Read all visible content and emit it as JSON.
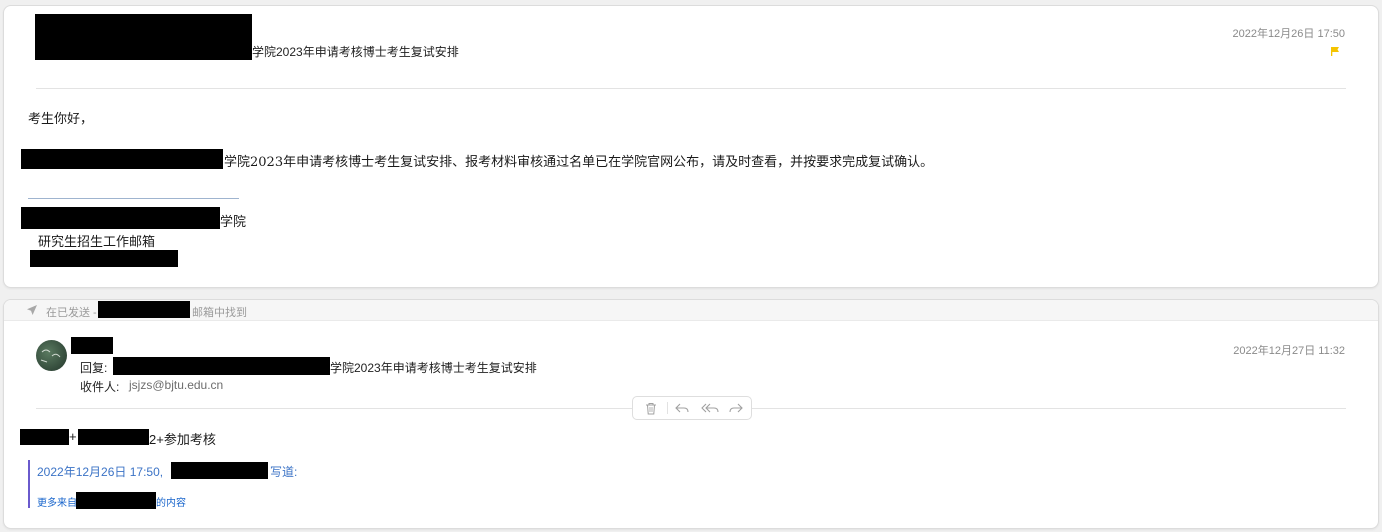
{
  "message1": {
    "subject_suffix": "学院2023年申请考核博士考生复试安排",
    "date": "2022年12月26日 17:50",
    "body": {
      "greeting": "考生你好，",
      "line1_suffix": "学院2023年申请考核博士考生复试安排、报考材料审核通过名单已在学院官网公布，请及时查看，并按要求完成复试确认。",
      "signature_college_suffix": "学院",
      "signature_office": "研究生招生工作邮箱"
    }
  },
  "found_bar": {
    "prefix": "在已发送 -",
    "suffix": "邮箱中找到"
  },
  "message2": {
    "reply_label": "回复:",
    "subject_suffix": "学院2023年申请考核博士考生复试安排",
    "recipients_label": "收件人:",
    "recipient": "jsjzs@bjtu.edu.cn",
    "date": "2022年12月27日 11:32",
    "body_plus": "+",
    "body_suffix": "2+参加考核",
    "quote_header_prefix": "2022年12月26日 17:50,",
    "quote_header_suffix": "写道:",
    "more_prefix": "更多来自",
    "more_suffix": "的内容"
  },
  "icons": {
    "flag": "flag-icon",
    "sent": "paper-plane-icon",
    "trash": "trash-icon",
    "reply": "reply-icon",
    "reply_all": "reply-all-icon",
    "forward": "forward-icon"
  },
  "colors": {
    "flag": "#f5c400",
    "quote_bar": "#6a5acd",
    "link": "#3b73c6"
  }
}
